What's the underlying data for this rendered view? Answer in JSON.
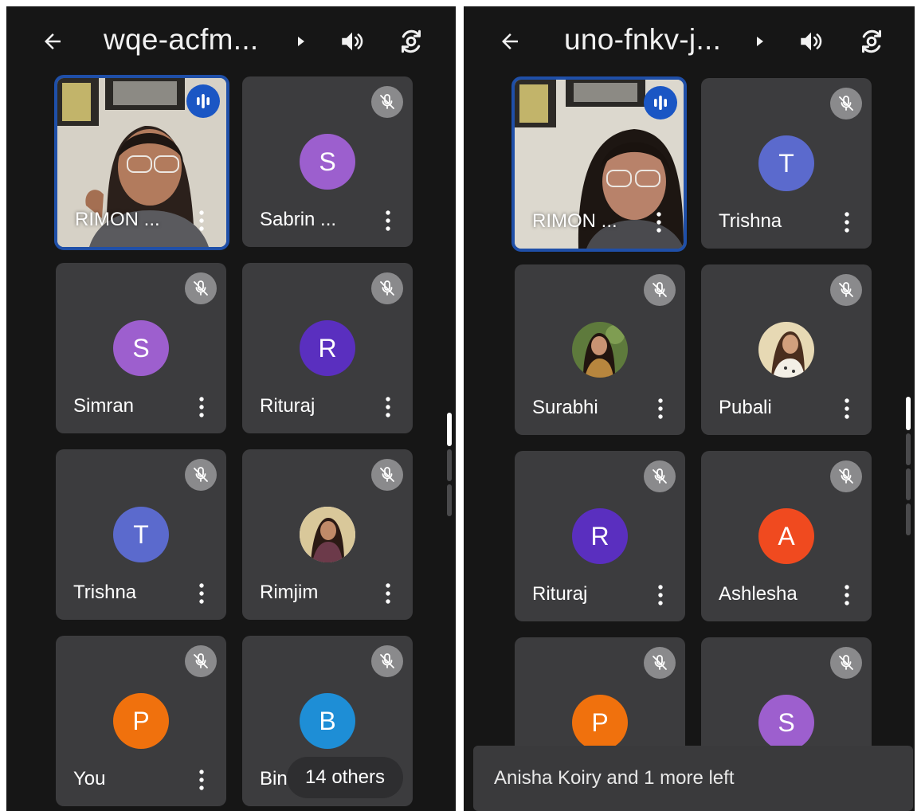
{
  "left": {
    "title": "wqe-acfm...",
    "participants": [
      {
        "name": "RIMON ...",
        "kind": "video",
        "speaking": true
      },
      {
        "name": "Sabrin ...",
        "initial": "S",
        "color": "#9c5fce",
        "muted": true
      },
      {
        "name": "Simran",
        "initial": "S",
        "color": "#9d5fce",
        "muted": true
      },
      {
        "name": "Rituraj",
        "initial": "R",
        "color": "#5a2fbf",
        "muted": true
      },
      {
        "name": "Trishna",
        "initial": "T",
        "color": "#5b6acd",
        "muted": true
      },
      {
        "name": "Rimjim",
        "kind": "photo",
        "muted": true
      },
      {
        "name": "You",
        "initial": "P",
        "color": "#f0710d",
        "muted": true
      },
      {
        "name": "Bini",
        "initial": "B",
        "color": "#1e8ed6",
        "muted": true
      }
    ],
    "others_label": "14 others"
  },
  "right": {
    "title": "uno-fnkv-j...",
    "participants": [
      {
        "name": "RIMON ...",
        "kind": "video",
        "speaking": true
      },
      {
        "name": "Trishna",
        "initial": "T",
        "color": "#5b6acd",
        "muted": true
      },
      {
        "name": "Surabhi",
        "kind": "photo",
        "muted": true
      },
      {
        "name": "Pubali",
        "kind": "photo",
        "muted": true
      },
      {
        "name": "Rituraj",
        "initial": "R",
        "color": "#5a2fbf",
        "muted": true
      },
      {
        "name": "Ashlesha",
        "initial": "A",
        "color": "#f04a1f",
        "muted": true
      },
      {
        "name": "",
        "initial": "P",
        "color": "#f0710d",
        "muted": true
      },
      {
        "name": "",
        "initial": "S",
        "color": "#9d5fce",
        "muted": true
      }
    ],
    "toast": "Anisha Koiry and 1 more left"
  },
  "icons": {
    "back": "arrow-left-icon",
    "caret": "caret-right-icon",
    "audio": "speaker-icon",
    "camera": "switch-camera-icon",
    "mic_off": "mic-off-icon",
    "speaking": "audio-level-icon",
    "more": "more-vert-icon"
  },
  "colors": {
    "background": "#161616",
    "tile": "#3c3c3e",
    "active_border": "#1f4fa8",
    "speaking_badge": "#1a56c4",
    "mute_badge": "#8a8a8c"
  }
}
